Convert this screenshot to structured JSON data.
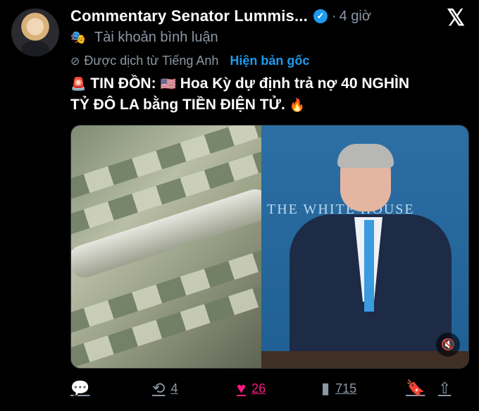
{
  "header": {
    "name": "Commentary Senator Lummis...",
    "time": "4 giờ",
    "account_type": "Tài khoản bình luận",
    "translated_from": "Được dịch từ Tiếng Anh",
    "show_original": "Hiện bản gốc"
  },
  "post": {
    "line1": "TIN ĐỒN:",
    "line1_rest": "Hoa Kỳ dự định trả nợ 40 NGHÌN",
    "line2": "TỶ ĐÔ LA bằng TIỀN ĐIỆN TỬ."
  },
  "media": {
    "left_caption": "THE WHITE HOUSE"
  },
  "actions": {
    "reposts": "4",
    "likes": "26",
    "views": "715"
  },
  "colors": {
    "accent": "#1d9bf0",
    "like": "#f91880",
    "muted": "#8b98a5"
  },
  "icons": [
    "verified-icon",
    "x-logo-icon",
    "mask-icon",
    "no-translate-icon",
    "siren-icon",
    "us-flag-icon",
    "fire-icon",
    "mute-icon",
    "reply-icon",
    "repost-icon",
    "like-icon",
    "views-icon",
    "bookmark-icon",
    "share-icon"
  ]
}
